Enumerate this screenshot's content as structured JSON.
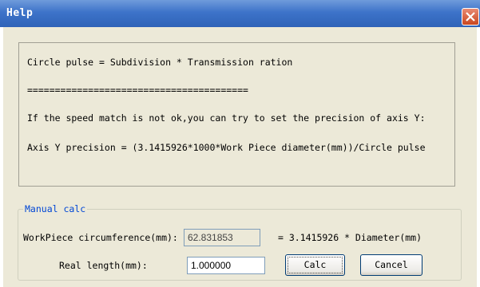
{
  "window": {
    "title": "Help",
    "close_icon": "close-icon"
  },
  "info": {
    "line1": "Circle pulse = Subdivision * Transmission ration",
    "separator": "========================================",
    "line2": "If the speed match is not ok,you can try to set the precision of axis Y:",
    "line3": "Axis Y precision = (3.1415926*1000*Work Piece diameter(mm))/Circle pulse"
  },
  "manual_calc": {
    "legend": "Manual calc",
    "circumference_label": "WorkPiece circumference(mm):",
    "circumference_value": "62.831853",
    "formula": "= 3.1415926 * Diameter(mm)",
    "real_length_label": "Real length(mm):",
    "real_length_value": "1.000000",
    "calc_button": "Calc",
    "cancel_button": "Cancel"
  },
  "colors": {
    "titlebar": "#3d73c9",
    "dialog_bg": "#ece9d8",
    "legend_text": "#0046d5"
  }
}
